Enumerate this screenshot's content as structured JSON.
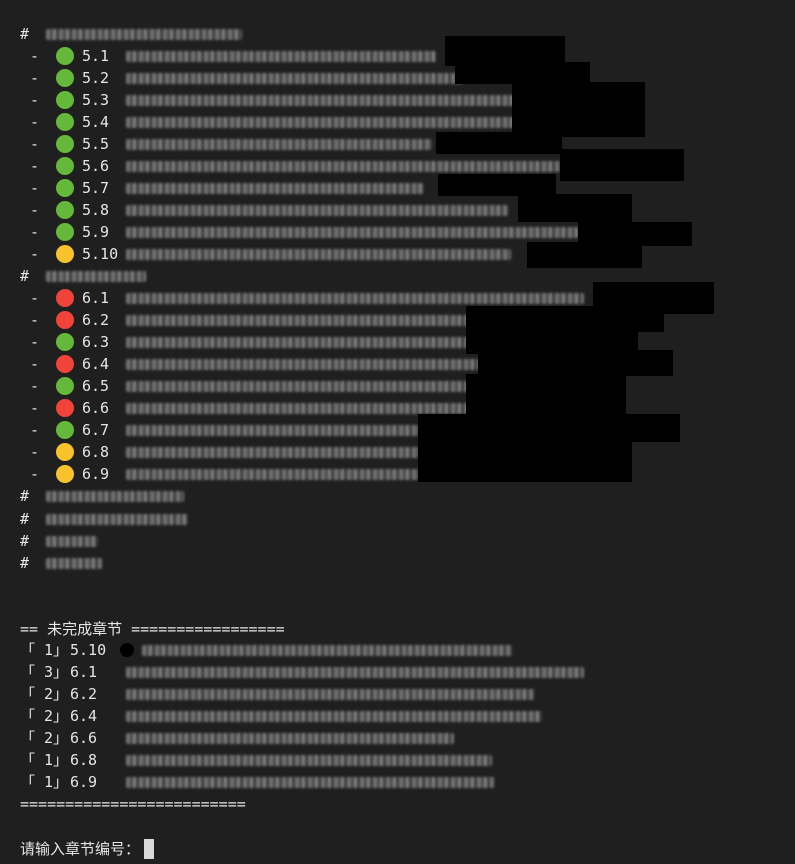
{
  "colors": {
    "background": "#1f1f1f",
    "text": "#e6e6e6",
    "green": "#65b839",
    "yellow": "#f8c22c",
    "red": "#f0443a"
  },
  "groups": [
    {
      "hash": "#",
      "items": [
        {
          "status": "green",
          "num": "5.1"
        },
        {
          "status": "green",
          "num": "5.2"
        },
        {
          "status": "green",
          "num": "5.3"
        },
        {
          "status": "green",
          "num": "5.4"
        },
        {
          "status": "green",
          "num": "5.5"
        },
        {
          "status": "green",
          "num": "5.6"
        },
        {
          "status": "green",
          "num": "5.7"
        },
        {
          "status": "green",
          "num": "5.8"
        },
        {
          "status": "green",
          "num": "5.9"
        },
        {
          "status": "yellow",
          "num": "5.10"
        }
      ]
    },
    {
      "hash": "#",
      "items": [
        {
          "status": "red",
          "num": "6.1"
        },
        {
          "status": "red",
          "num": "6.2"
        },
        {
          "status": "green",
          "num": "6.3"
        },
        {
          "status": "red",
          "num": "6.4"
        },
        {
          "status": "green",
          "num": "6.5"
        },
        {
          "status": "red",
          "num": "6.6"
        },
        {
          "status": "green",
          "num": "6.7"
        },
        {
          "status": "yellow",
          "num": "6.8"
        },
        {
          "status": "yellow",
          "num": "6.9"
        }
      ]
    }
  ],
  "extra_hashes": [
    "#",
    "#",
    "#",
    "#"
  ],
  "dash": "-",
  "incomplete": {
    "header": "== 未完成章节 =================",
    "rows": [
      {
        "count": "「 1」",
        "num": "5.10"
      },
      {
        "count": "「 3」",
        "num": "6.1"
      },
      {
        "count": "「 2」",
        "num": "6.2"
      },
      {
        "count": "「 2」",
        "num": "6.4"
      },
      {
        "count": "「 2」",
        "num": "6.6"
      },
      {
        "count": "「 1」",
        "num": "6.8"
      },
      {
        "count": "「 1」",
        "num": "6.9"
      }
    ],
    "footer": "========================="
  },
  "prompt": "请输入章节编号："
}
